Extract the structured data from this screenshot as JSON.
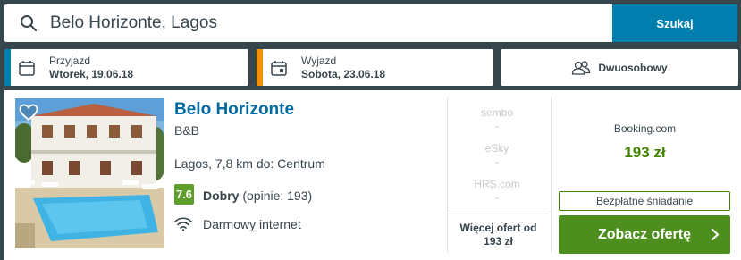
{
  "search": {
    "value": "Belo Horizonte, Lagos",
    "button_label": "Szukaj"
  },
  "checkin": {
    "label": "Przyjazd",
    "value": "Wtorek, 19.06.18",
    "accent": "#007faf"
  },
  "checkout": {
    "label": "Wyjazd",
    "value": "Sobota, 23.06.18",
    "accent": "#f48f00"
  },
  "room": {
    "label": "Dwuosobowy",
    "icon": "people-icon"
  },
  "hotel": {
    "name": "Belo Horizonte",
    "type": "B&B",
    "location": "Lagos, 7,8 km do: Centrum",
    "rating_score": "7.6",
    "rating_label": "Dobry",
    "rating_count": "(opinie: 193)",
    "amenity": "Darmowy internet"
  },
  "partners": [
    {
      "name": "sembo",
      "price": "-"
    },
    {
      "name": "eSky",
      "price": "-"
    },
    {
      "name": "HRS.com",
      "price": "-"
    }
  ],
  "more_offers": {
    "line1": "Więcej ofert od",
    "line2": "193 zł"
  },
  "best_deal": {
    "site": "Booking.com",
    "price": "193 zł",
    "breakfast": "Bezpłatne śniadanie",
    "button_label": "Zobacz ofertę"
  },
  "colors": {
    "header_bg": "#37454d",
    "link": "#00699d",
    "search_button": "#007faf",
    "price_green": "#428500",
    "deal_button": "#4e8e1f",
    "rating_badge": "#5e9e2a"
  }
}
